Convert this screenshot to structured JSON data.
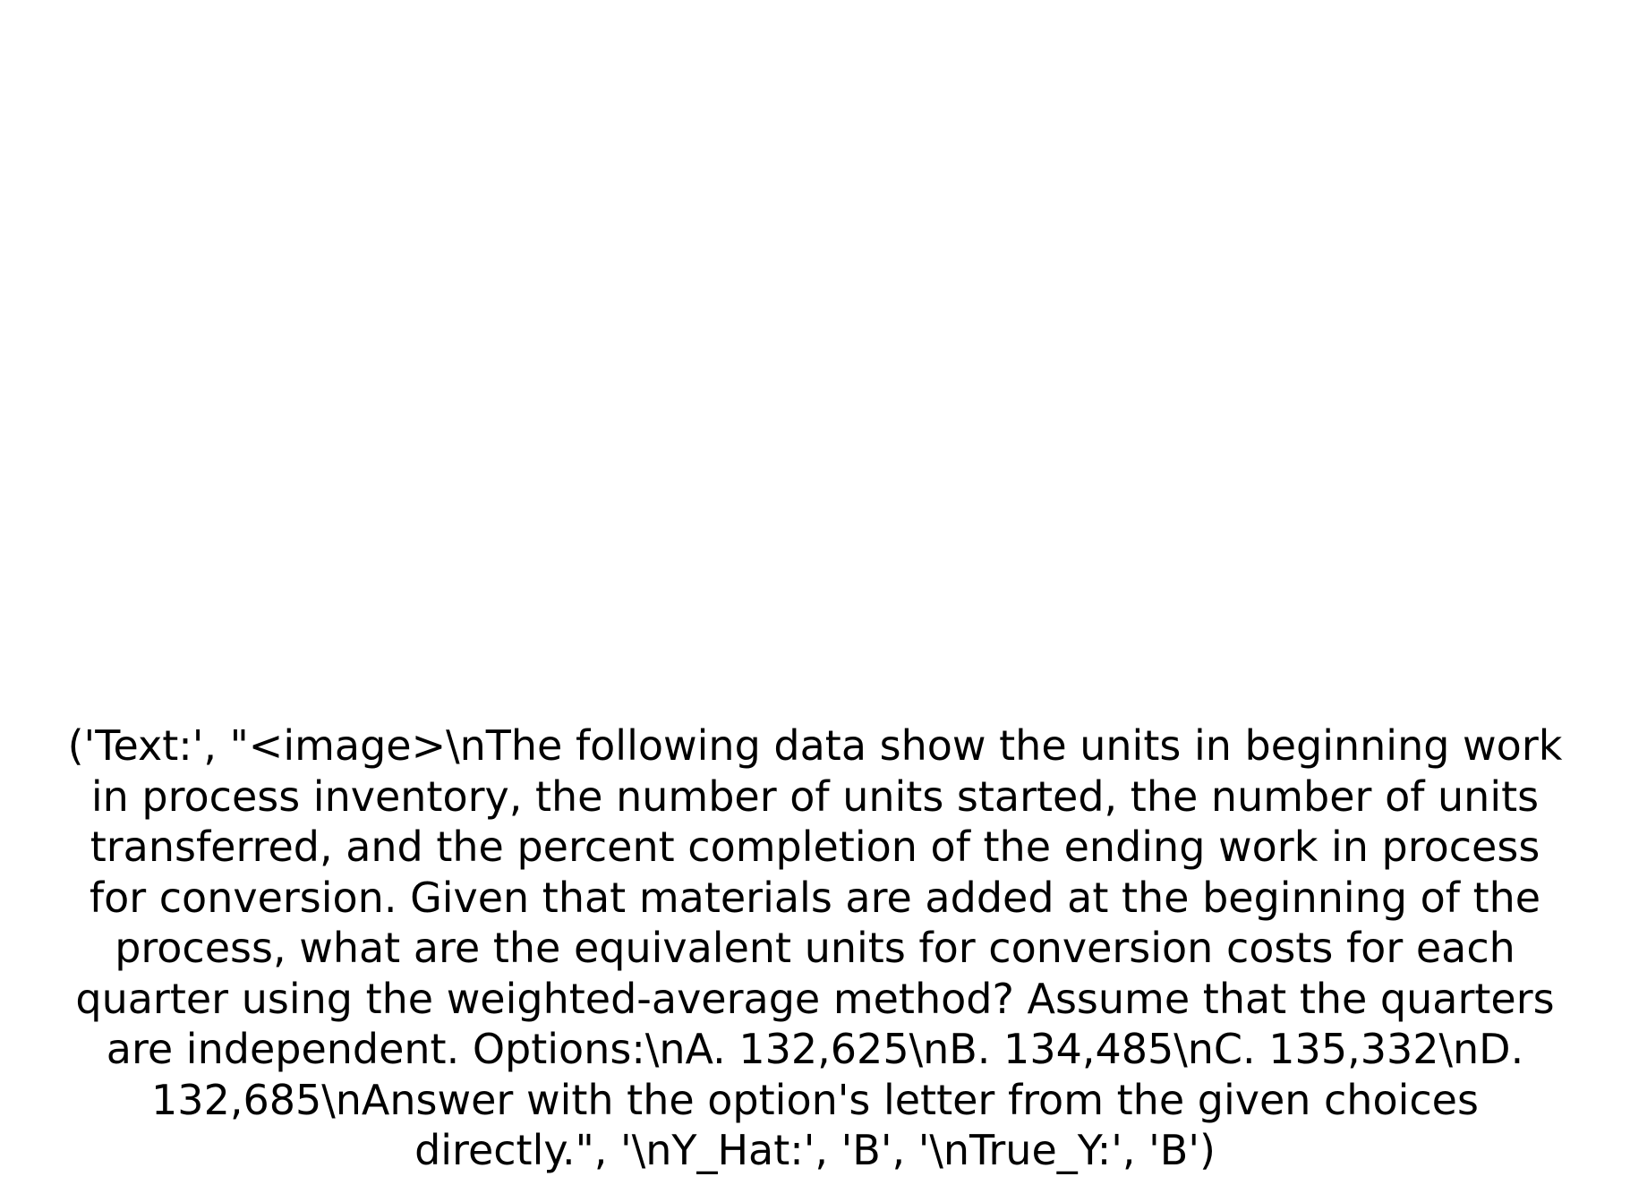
{
  "document": {
    "lines": [
      "('Text:', \"<image>\\nThe following data show the units in beginning work",
      "in process inventory, the number of units started, the number of units",
      "transferred, and the percent completion of the ending work in process",
      "for conversion. Given that materials are added at the beginning of the",
      "process, what are the equivalent units for conversion costs for each",
      "quarter using the weighted-average method? Assume that the quarters",
      "are independent. Options:\\nA. 132,625\\nB. 134,485\\nC. 135,332\\nD.",
      "132,685\\nAnswer with the option's letter from the given choices",
      "directly.\", '\\nY_Hat:', 'B', '\\nTrue_Y:', 'B')"
    ]
  },
  "colors": {
    "background": "#ffffff",
    "text": "#000000"
  }
}
